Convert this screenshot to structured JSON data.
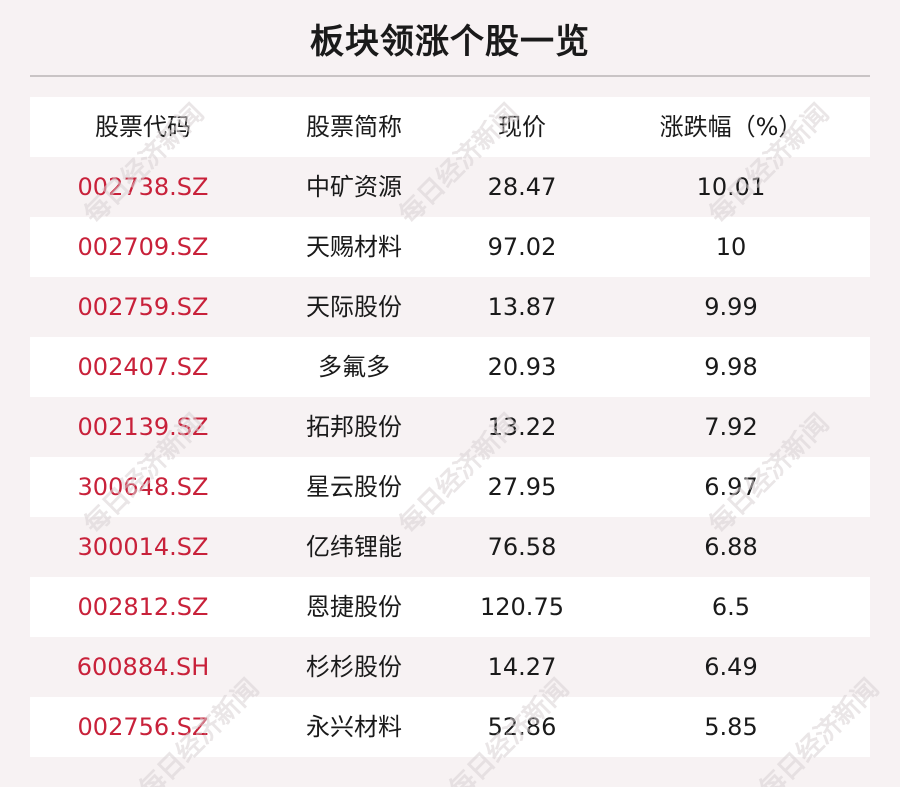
{
  "title": "板块领涨个股一览",
  "table": {
    "headers": [
      "股票代码",
      "股票简称",
      "现价",
      "涨跌幅（%）"
    ],
    "rows": [
      {
        "code": "002738.SZ",
        "name": "中矿资源",
        "price": "28.47",
        "change": "10.01"
      },
      {
        "code": "002709.SZ",
        "name": "天赐材料",
        "price": "97.02",
        "change": "10"
      },
      {
        "code": "002759.SZ",
        "name": "天际股份",
        "price": "13.87",
        "change": "9.99"
      },
      {
        "code": "002407.SZ",
        "name": "多氟多",
        "price": "20.93",
        "change": "9.98"
      },
      {
        "code": "002139.SZ",
        "name": "拓邦股份",
        "price": "13.22",
        "change": "7.92"
      },
      {
        "code": "300648.SZ",
        "name": "星云股份",
        "price": "27.95",
        "change": "6.97"
      },
      {
        "code": "300014.SZ",
        "name": "亿纬锂能",
        "price": "76.58",
        "change": "6.88"
      },
      {
        "code": "002812.SZ",
        "name": "恩捷股份",
        "price": "120.75",
        "change": "6.5"
      },
      {
        "code": "600884.SH",
        "name": "杉杉股份",
        "price": "14.27",
        "change": "6.49"
      },
      {
        "code": "002756.SZ",
        "name": "永兴材料",
        "price": "52.86",
        "change": "5.85"
      }
    ]
  },
  "watermark": "每日经济新闻",
  "colors": {
    "code_text": "#c8213a",
    "body_text": "#1a1a1a",
    "row_white": "#ffffff",
    "row_tint": "#f7f2f3"
  }
}
